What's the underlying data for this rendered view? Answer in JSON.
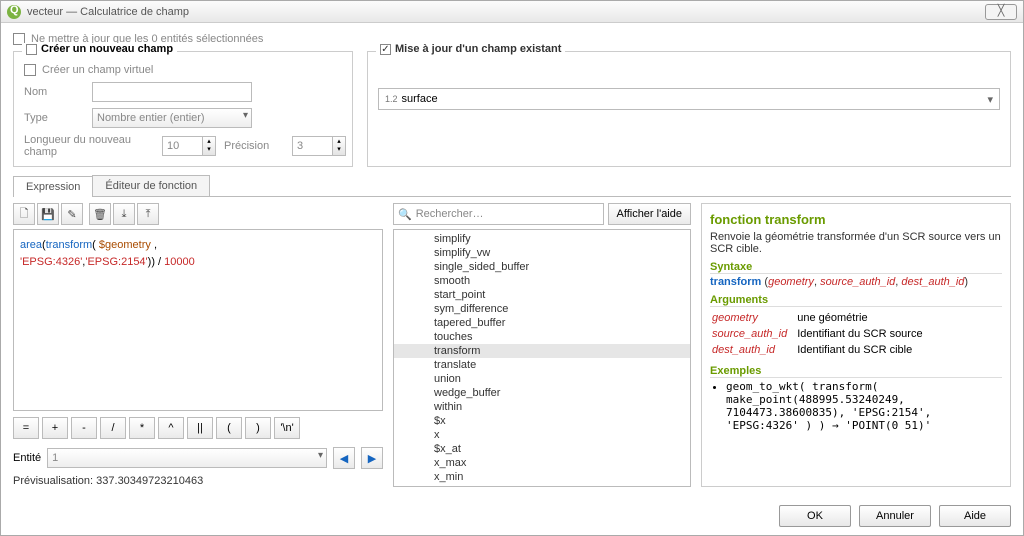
{
  "window": {
    "title": "vecteur — Calculatrice de champ",
    "close_symbol": "╳"
  },
  "top_checkbox": {
    "label": "Ne mettre à jour que les 0 entités sélectionnées"
  },
  "panel_new": {
    "title": "Créer un nouveau champ",
    "virtual": "Créer un champ virtuel",
    "name_label": "Nom",
    "type_label": "Type",
    "type_value": "Nombre entier (entier)",
    "length_label": "Longueur du nouveau champ",
    "length_value": "10",
    "precision_label": "Précision",
    "precision_value": "3"
  },
  "panel_update": {
    "title": "Mise à jour d'un champ existant",
    "field_icon": "1.2",
    "field": "surface"
  },
  "tabs": {
    "expression": "Expression",
    "editor": "Éditeur de fonction"
  },
  "icons": [
    "🗋",
    "💾",
    "✎",
    "🗑",
    "⤓",
    "⤒"
  ],
  "expression_tokens": {
    "fn1": "area",
    "p1": "(",
    "fn2": "transform",
    "p2": "( ",
    "var": "$geometry",
    "p3": " ,\n",
    "str1": "'EPSG:4326'",
    "p4": ",",
    "str2": "'EPSG:2154'",
    "p5": ")) / ",
    "num": "10000"
  },
  "operators": [
    "=",
    "+",
    "-",
    "/",
    "*",
    "^",
    "||",
    "(",
    ")",
    "'\\n'"
  ],
  "entity": {
    "label": "Entité",
    "value": "1"
  },
  "preview": {
    "label": "Prévisualisation:",
    "value": "337.30349723210463"
  },
  "search": {
    "placeholder": "Rechercher…",
    "help": "Afficher l'aide"
  },
  "functions": [
    "simplify",
    "simplify_vw",
    "single_sided_buffer",
    "smooth",
    "start_point",
    "sym_difference",
    "tapered_buffer",
    "touches",
    "transform",
    "translate",
    "union",
    "wedge_buffer",
    "within",
    "$x",
    "x",
    "$x_at",
    "x_max",
    "x_min"
  ],
  "functions_selected_index": 8,
  "help": {
    "title": "fonction transform",
    "desc": "Renvoie la géométrie transformée d'un SCR source vers un SCR cible.",
    "syntax_h": "Syntaxe",
    "syntax_fn": "transform",
    "syntax_args": [
      "geometry",
      "source_auth_id",
      "dest_auth_id"
    ],
    "args_h": "Arguments",
    "args": [
      {
        "name": "geometry",
        "desc": "une géométrie"
      },
      {
        "name": "source_auth_id",
        "desc": "Identifiant du SCR source"
      },
      {
        "name": "dest_auth_id",
        "desc": "Identifiant du SCR cible"
      }
    ],
    "ex_h": "Exemples",
    "ex_code": "geom_to_wkt( transform( make_point(488995.53240249, 7104473.38600835), 'EPSG:2154', 'EPSG:4326' ) ) → 'POINT(0 51)'"
  },
  "buttons": {
    "ok": "OK",
    "cancel": "Annuler",
    "help": "Aide"
  }
}
